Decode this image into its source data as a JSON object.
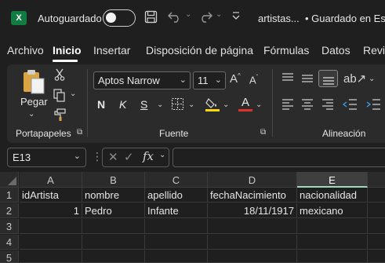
{
  "titlebar": {
    "app_icon": "excel-logo",
    "app_letter": "X",
    "autosave_label": "Autoguardado",
    "autosave_state": "off",
    "save_icon": "save-icon",
    "undo_icon": "undo-icon",
    "redo_icon": "redo-icon",
    "qat_icon": "chevron-down-icon",
    "file_title": "artistas...",
    "status": "• Guardado en Este P"
  },
  "tabs": [
    {
      "label": "Archivo"
    },
    {
      "label": "Inicio",
      "active": true
    },
    {
      "label": "Insertar"
    },
    {
      "label": "Disposición de página"
    },
    {
      "label": "Fórmulas"
    },
    {
      "label": "Datos"
    },
    {
      "label": "Revis"
    }
  ],
  "ribbon": {
    "clipboard": {
      "paste_label": "Pegar",
      "group_label": "Portapapeles"
    },
    "font": {
      "font_name": "Aptos Narrow",
      "font_size": "11",
      "bold": "N",
      "italic": "K",
      "underline": "S",
      "font_color_letter": "A",
      "group_label": "Fuente"
    },
    "alignment": {
      "group_label": "Alineación"
    },
    "colors": {
      "highlight": "#f5d90a",
      "font_color": "#e03131"
    }
  },
  "formula_bar": {
    "name_box": "E13",
    "fx_label": "fx",
    "value": ""
  },
  "sheet": {
    "columns": [
      "A",
      "B",
      "C",
      "D",
      "E"
    ],
    "selected_column": "E",
    "rows": [
      {
        "num": "1",
        "cells": [
          "idArtista",
          "nombre",
          "apellido",
          "fechaNacimiento",
          "nacionalidad"
        ]
      },
      {
        "num": "2",
        "cells": [
          "1",
          "Pedro",
          "Infante",
          "18/11/1917",
          "mexicano"
        ]
      },
      {
        "num": "3",
        "cells": [
          "",
          "",
          "",
          "",
          ""
        ]
      },
      {
        "num": "4",
        "cells": [
          "",
          "",
          "",
          "",
          ""
        ]
      },
      {
        "num": "5",
        "cells": [
          "",
          "",
          "",
          "",
          ""
        ]
      }
    ]
  }
}
